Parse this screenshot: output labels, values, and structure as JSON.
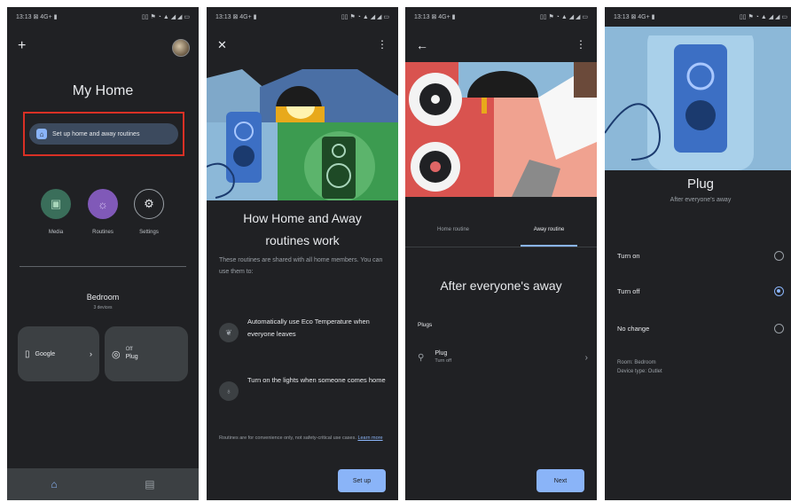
{
  "status": {
    "time": "13:13 ⊠ 4G+ ▮",
    "icons": "▯▯ ⚑ ◔ ▲ ◢ ◢ ▭"
  },
  "panel1": {
    "title": "My Home",
    "setup_chip": "Set up home and away routines",
    "shortcuts": [
      {
        "label": "Media",
        "icon": "play-box-icon"
      },
      {
        "label": "Routines",
        "icon": "sun-icon"
      },
      {
        "label": "Settings",
        "icon": "gear-icon"
      }
    ],
    "room": {
      "name": "Bedroom",
      "count": "3 devices"
    },
    "devices": [
      {
        "name": "Google",
        "chevron": "›"
      },
      {
        "state": "Off",
        "name": "Plug"
      }
    ],
    "colors": {
      "media": "#3a6e5a",
      "routines": "#8059b8",
      "highlight": "#d93025"
    }
  },
  "panel2": {
    "heading_line1": "How Home and Away",
    "heading_line2": "routines work",
    "desc": "These routines are shared with all home members. You can use them to:",
    "rows": [
      {
        "text": "Automatically use Eco Temperature when everyone leaves",
        "icon": "leaf-icon"
      },
      {
        "text": "Turn on the lights when someone comes home",
        "icon": "bulb-icon"
      }
    ],
    "fine_print": "Routines are for convenience only, not safety-critical use cases.",
    "learn_more": "Learn more",
    "button": "Set up"
  },
  "panel3": {
    "tabs": [
      "Home routine",
      "Away routine"
    ],
    "active_tab": 1,
    "heading": "After everyone's away",
    "section": "Plugs",
    "item": {
      "name": "Plug",
      "state": "Turn off"
    },
    "button": "Next"
  },
  "panel4": {
    "title": "Plug",
    "subtitle": "After everyone's away",
    "options": [
      {
        "label": "Turn on",
        "checked": false
      },
      {
        "label": "Turn off",
        "checked": true
      },
      {
        "label": "No change",
        "checked": false
      }
    ],
    "room": "Room: Bedroom",
    "device_type": "Device type: Outlet"
  }
}
